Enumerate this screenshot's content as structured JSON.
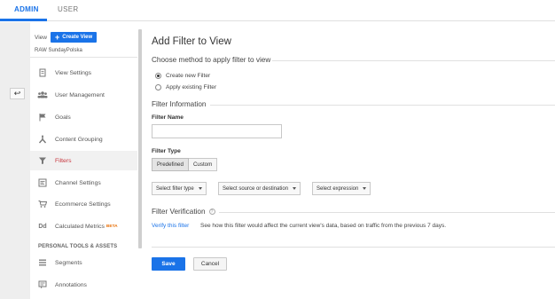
{
  "tabs": {
    "admin": "ADMIN",
    "user": "USER"
  },
  "sidebar": {
    "view_label": "View",
    "create_view_label": "Create View",
    "account_name": "RAW SundayPolska",
    "items": [
      {
        "label": "View Settings",
        "icon": "document-icon"
      },
      {
        "label": "User Management",
        "icon": "users-icon"
      },
      {
        "label": "Goals",
        "icon": "flag-icon"
      },
      {
        "label": "Content Grouping",
        "icon": "content-grouping-icon"
      },
      {
        "label": "Filters",
        "icon": "funnel-icon",
        "active": true
      },
      {
        "label": "Channel Settings",
        "icon": "channel-icon"
      },
      {
        "label": "Ecommerce Settings",
        "icon": "cart-icon"
      },
      {
        "label": "Calculated Metrics",
        "icon": "calculated-metrics-icon",
        "badge": "BETA"
      }
    ],
    "section_header": "PERSONAL TOOLS & ASSETS",
    "tools": [
      {
        "label": "Segments",
        "icon": "segments-icon"
      },
      {
        "label": "Annotations",
        "icon": "annotations-icon"
      }
    ]
  },
  "main": {
    "title": "Add Filter to View",
    "method_section": "Choose method to apply filter to view",
    "radio_create": "Create new Filter",
    "radio_apply": "Apply existing Filter",
    "info_section": "Filter Information",
    "filter_name_label": "Filter Name",
    "filter_name_value": "",
    "filter_type_label": "Filter Type",
    "toggle_predefined": "Predefined",
    "toggle_custom": "Custom",
    "dropdown_type": "Select filter type",
    "dropdown_source": "Select source or destination",
    "dropdown_expression": "Select expression",
    "verification_section": "Filter Verification",
    "verify_link": "Verify this filter",
    "verify_desc": "See how this filter would affect the current view's data, based on traffic from the previous 7 days.",
    "save_label": "Save",
    "cancel_label": "Cancel"
  },
  "colors": {
    "accent": "#1a73e8",
    "active_item": "#c8373f",
    "beta": "#e8710a"
  }
}
